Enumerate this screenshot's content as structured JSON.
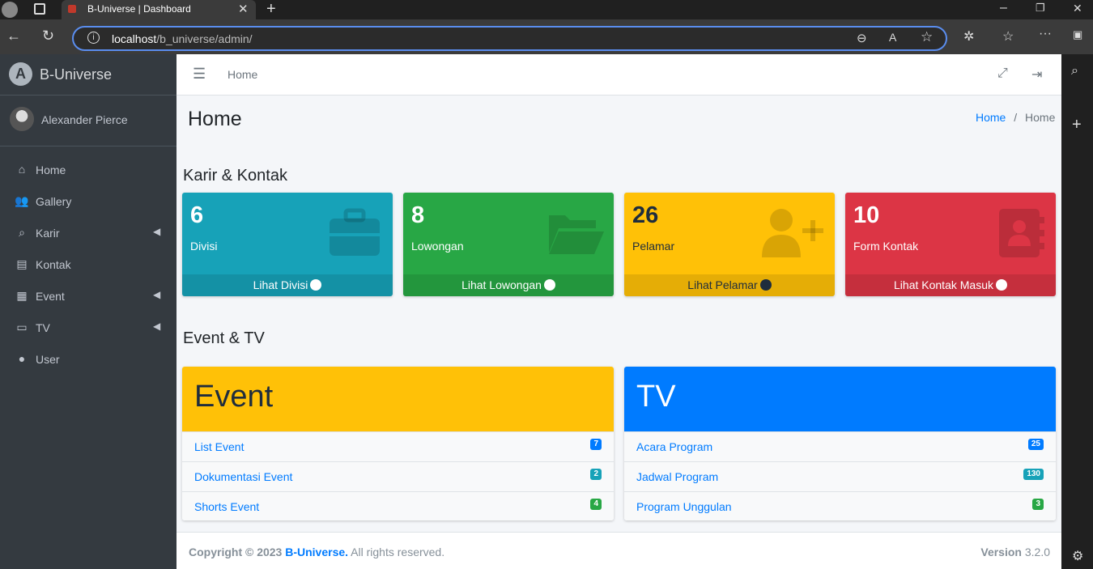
{
  "browser": {
    "tab_title": "B-Universe | Dashboard",
    "url_host": "localhost",
    "url_path": "/b_universe/admin/"
  },
  "sidebar": {
    "brand": "B-Universe",
    "user": "Alexander Pierce",
    "items": [
      {
        "label": "Home",
        "icon": "home-icon",
        "caret": false
      },
      {
        "label": "Gallery",
        "icon": "users-icon",
        "caret": false
      },
      {
        "label": "Karir",
        "icon": "search-dollar-icon",
        "caret": true
      },
      {
        "label": "Kontak",
        "icon": "address-book-icon",
        "caret": false
      },
      {
        "label": "Event",
        "icon": "calendar-icon",
        "caret": true
      },
      {
        "label": "TV",
        "icon": "desktop-icon",
        "caret": true
      },
      {
        "label": "User",
        "icon": "user-icon",
        "caret": false
      }
    ]
  },
  "topnav": {
    "home_link": "Home"
  },
  "page": {
    "title": "Home",
    "breadcrumb_link": "Home",
    "breadcrumb_sep": "/",
    "breadcrumb_current": "Home"
  },
  "section1": "Karir & Kontak",
  "boxes": [
    {
      "number": "6",
      "label": "Divisi",
      "link": "Lihat Divisi",
      "color": "#17a2b8",
      "icon": "briefcase-icon"
    },
    {
      "number": "8",
      "label": "Lowongan",
      "link": "Lihat Lowongan",
      "color": "#28a745",
      "icon": "folder-open-icon"
    },
    {
      "number": "26",
      "label": "Pelamar",
      "link": "Lihat Pelamar",
      "color": "#ffc107",
      "icon": "user-plus-icon"
    },
    {
      "number": "10",
      "label": "Form Kontak",
      "link": "Lihat Kontak Masuk",
      "color": "#dc3545",
      "icon": "contact-book-icon"
    }
  ],
  "section2": "Event & TV",
  "event_card": {
    "title": "Event",
    "color": "#ffc107",
    "rows": [
      {
        "label": "List Event",
        "badge": "7",
        "badge_color": "#007bff"
      },
      {
        "label": "Dokumentasi Event",
        "badge": "2",
        "badge_color": "#17a2b8"
      },
      {
        "label": "Shorts Event",
        "badge": "4",
        "badge_color": "#28a745"
      }
    ]
  },
  "tv_card": {
    "title": "TV",
    "color": "#007bff",
    "rows": [
      {
        "label": "Acara Program",
        "badge": "25",
        "badge_color": "#007bff"
      },
      {
        "label": "Jadwal Program",
        "badge": "130",
        "badge_color": "#17a2b8"
      },
      {
        "label": "Program Unggulan",
        "badge": "3",
        "badge_color": "#28a745"
      }
    ]
  },
  "footer": {
    "copyright": "Copyright © 2023",
    "brand": "B-Universe.",
    "rights": "All rights reserved.",
    "version_label": "Version",
    "version": "3.2.0"
  }
}
